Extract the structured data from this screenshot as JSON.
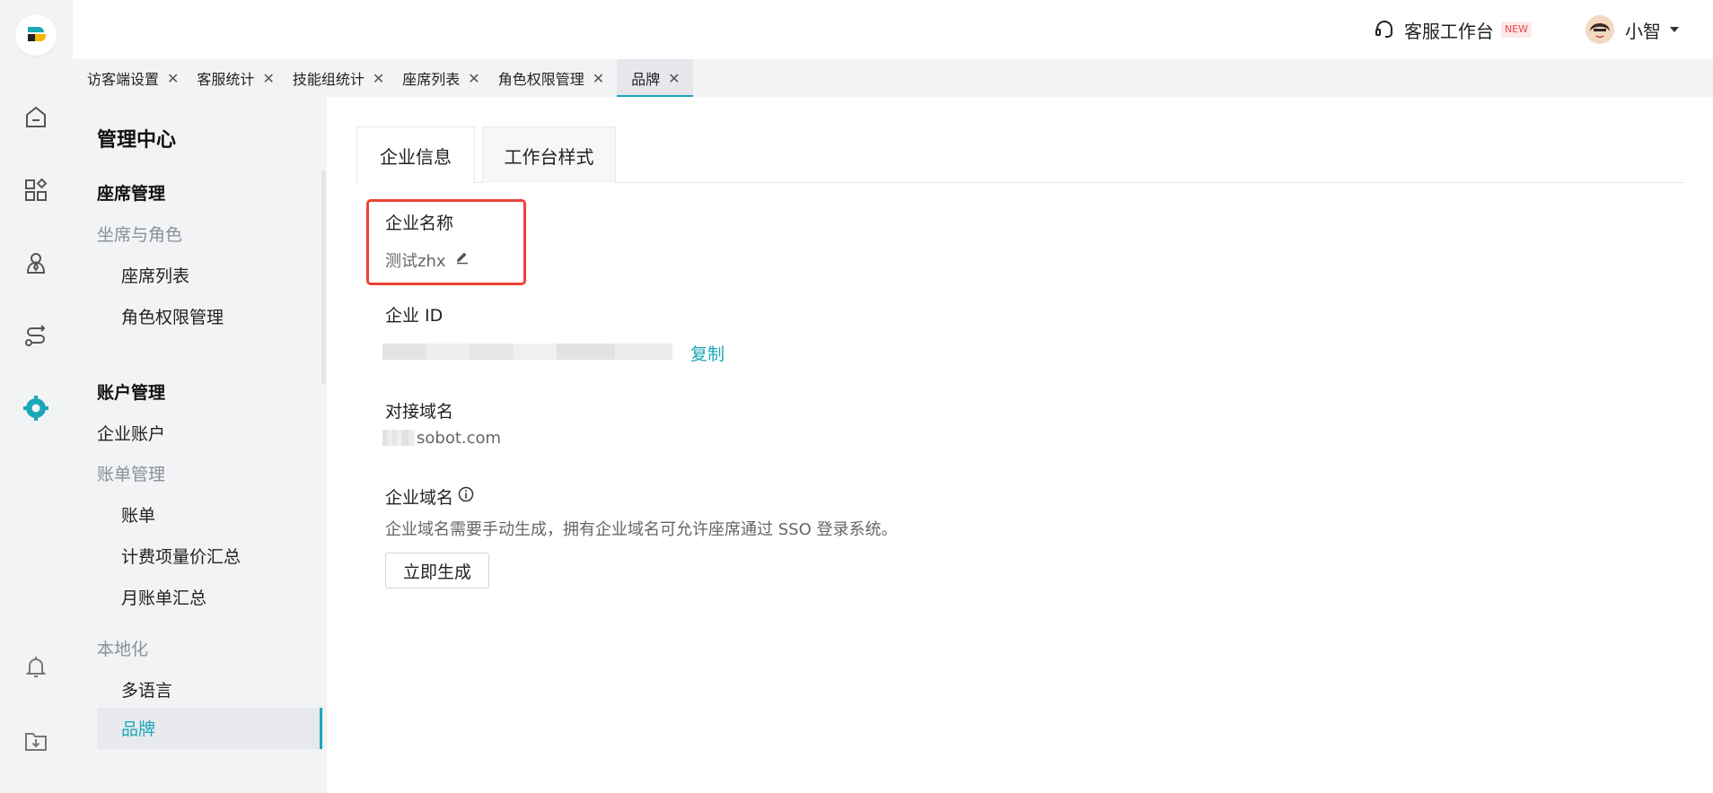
{
  "topbar": {
    "workbench_label": "客服工作台",
    "new_badge": "NEW",
    "user_name": "小智"
  },
  "tabs": [
    {
      "label": "访客端设置"
    },
    {
      "label": "客服统计"
    },
    {
      "label": "技能组统计"
    },
    {
      "label": "座席列表"
    },
    {
      "label": "角色权限管理"
    },
    {
      "label": "品牌",
      "active": true
    }
  ],
  "sidebar": {
    "title": "管理中心",
    "sections": [
      {
        "label": "座席管理"
      },
      {
        "label": "坐席与角色"
      },
      {
        "label": "座席列表"
      },
      {
        "label": "角色权限管理"
      },
      {
        "label": "账户管理"
      },
      {
        "label": "企业账户"
      },
      {
        "label": "账单管理"
      },
      {
        "label": "账单"
      },
      {
        "label": "计费项量价汇总"
      },
      {
        "label": "月账单汇总"
      },
      {
        "label": "本地化"
      },
      {
        "label": "多语言"
      },
      {
        "label": "品牌"
      }
    ]
  },
  "main": {
    "tabs": [
      {
        "label": "企业信息"
      },
      {
        "label": "工作台样式"
      }
    ],
    "company_name_label": "企业名称",
    "company_name_value": "测试zhx",
    "company_id_label": "企业 ID",
    "copy_label": "复制",
    "domain_label": "对接域名",
    "domain_value": "sobot.com",
    "enterprise_domain_label": "企业域名",
    "enterprise_domain_desc": "企业域名需要手动生成，拥有企业域名可允许座席通过 SSO 登录系统。",
    "generate_button": "立即生成"
  },
  "colors": {
    "accent": "#1aa7b8",
    "highlight": "#ea4335",
    "new_badge": "#e84a4a"
  },
  "icons": [
    "home-icon",
    "apps-icon",
    "user-icon",
    "route-icon",
    "gear-icon",
    "bell-icon",
    "download-folder-icon",
    "edit-icon",
    "info-icon",
    "headset-icon"
  ]
}
